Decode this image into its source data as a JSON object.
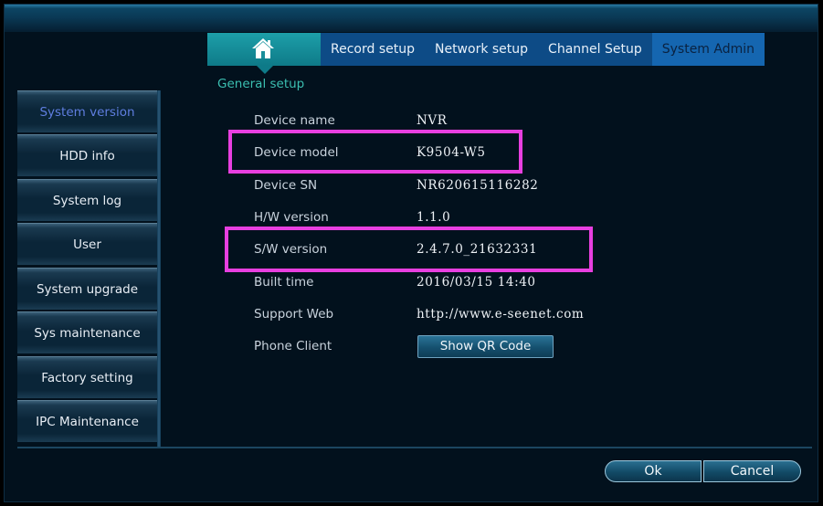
{
  "tabs": {
    "home_icon": "home-icon",
    "items": [
      {
        "label": "Record setup"
      },
      {
        "label": "Network setup"
      },
      {
        "label": "Channel Setup"
      },
      {
        "label": "System Admin"
      }
    ]
  },
  "section_title": "General setup",
  "sidebar": {
    "items": [
      {
        "label": "System version"
      },
      {
        "label": "HDD info"
      },
      {
        "label": "System log"
      },
      {
        "label": "User"
      },
      {
        "label": "System upgrade"
      },
      {
        "label": "Sys maintenance"
      },
      {
        "label": "Factory setting"
      },
      {
        "label": "IPC Maintenance"
      }
    ]
  },
  "info": {
    "device_name": {
      "label": "Device name",
      "value": "NVR"
    },
    "device_model": {
      "label": "Device model",
      "value": "K9504-W5"
    },
    "device_sn": {
      "label": "Device SN",
      "value": "NR620615116282"
    },
    "hw_version": {
      "label": "H/W version",
      "value": "1.1.0"
    },
    "sw_version": {
      "label": "S/W version",
      "value": "2.4.7.0_21632331"
    },
    "built_time": {
      "label": "Built time",
      "value": "2016/03/15 14:40"
    },
    "support_web": {
      "label": "Support Web",
      "value": "http://www.e-seenet.com"
    },
    "phone_client": {
      "label": "Phone Client",
      "button": "Show QR Code"
    }
  },
  "footer": {
    "ok_label": "Ok",
    "cancel_label": "Cancel"
  },
  "colors": {
    "highlight": "#e83fe0",
    "accent": "#3bbfb1",
    "active_tab": "#1566b0"
  }
}
